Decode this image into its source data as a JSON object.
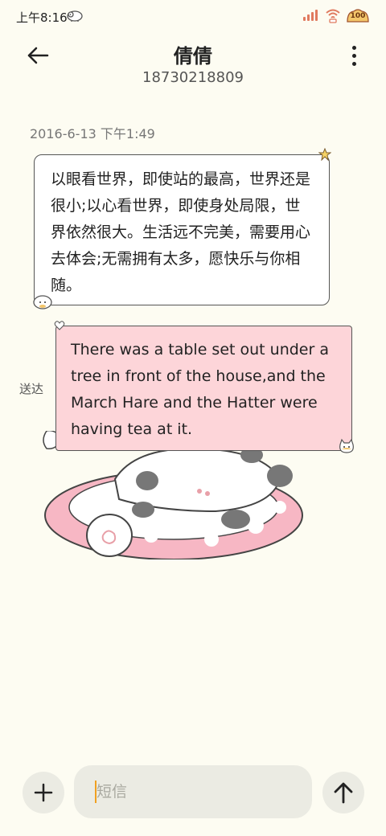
{
  "status_bar": {
    "time": "上午8:16",
    "battery": "100",
    "icons": [
      "sheep-icon",
      "signal-icon",
      "wifi-icon",
      "battery-icon"
    ]
  },
  "header": {
    "contact_name": "倩倩",
    "phone_number": "18730218809",
    "icons": [
      "back-arrow-icon",
      "more-vertical-icon"
    ]
  },
  "conversation": {
    "timestamp": "2016-6-13 下午1:49",
    "incoming_message": "以眼看世界，即使站的最高，世界还是很小;以心看世界，即使身处局限，世界依然很大。生活远不完美，需要用心去体会;无需拥有太多，愿快乐与你相随。",
    "outgoing_message": "There was a table set out under a tree in front of the house,and the March Hare and the Hatter were having tea at it.",
    "sent_status": "送达"
  },
  "composer": {
    "placeholder": "短信",
    "icons": [
      "plus-icon",
      "send-arrow-icon"
    ]
  },
  "colors": {
    "background": "#fdfcf2",
    "incoming_bubble": "#ffffff",
    "outgoing_bubble": "#fdd5d9",
    "composer": "#ebebe3",
    "caret": "#f0a020"
  }
}
